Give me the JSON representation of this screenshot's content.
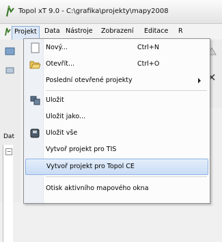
{
  "window": {
    "title": "Topol xT 9.0 - C:\\grafika\\projekty\\mapy2008"
  },
  "menubar": {
    "items": [
      {
        "label": "Projekt"
      },
      {
        "label": "Data"
      },
      {
        "label": "Nástroje"
      },
      {
        "label": "Zobrazení"
      },
      {
        "label": "Editace"
      },
      {
        "label": "R"
      }
    ]
  },
  "left_panel": {
    "label": "Dat"
  },
  "projekt_menu": {
    "items": [
      {
        "label": "Nový...",
        "shortcut": "Ctrl+N",
        "icon": "new-document-icon"
      },
      {
        "label": "Otevřít...",
        "shortcut": "Ctrl+O",
        "icon": "open-folder-icon"
      },
      {
        "label": "Poslední otevřené projekty",
        "shortcut": "",
        "icon": "",
        "submenu": true
      },
      {
        "label": "Uložit",
        "shortcut": "",
        "icon": "save-icon"
      },
      {
        "label": "Uložit jako...",
        "shortcut": "",
        "icon": ""
      },
      {
        "label": "Uložit vše",
        "shortcut": "",
        "icon": "save-all-icon"
      },
      {
        "label": "Vytvoř projekt pro TIS",
        "shortcut": "",
        "icon": ""
      },
      {
        "label": "Vytvoř projekt pro Topol CE",
        "shortcut": "",
        "icon": "",
        "highlighted": true
      },
      {
        "label": "Otisk aktivního mapového okna",
        "shortcut": "",
        "icon": ""
      }
    ]
  },
  "colors": {
    "highlight_bg": "#c9dcf5",
    "highlight_border": "#8fb2e4",
    "menu_bg": "#fcfcfc"
  }
}
